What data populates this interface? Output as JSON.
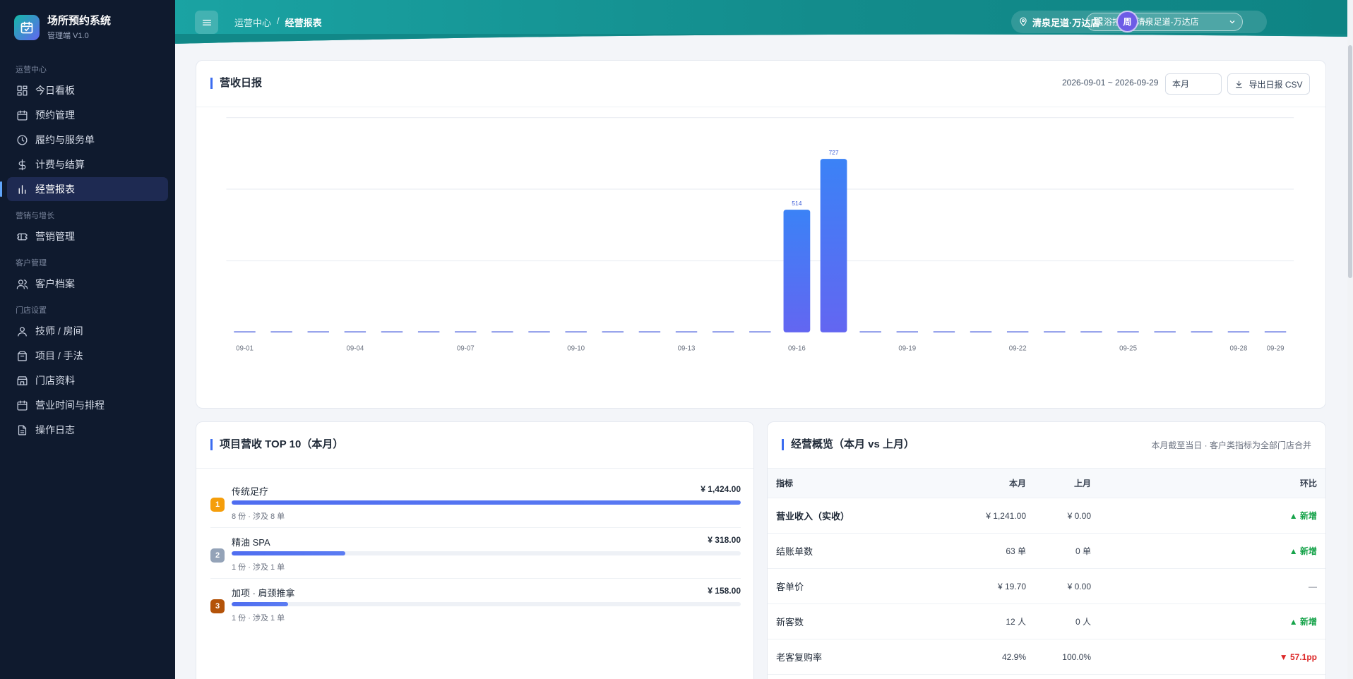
{
  "app": {
    "title": "场所预约系统",
    "subtitle": "管理端 V1.0"
  },
  "sidebar": {
    "groups": [
      {
        "label": "运营中心",
        "items": [
          {
            "label": "今日看板",
            "icon": "dashboard-icon"
          },
          {
            "label": "预约管理",
            "icon": "calendar-icon"
          },
          {
            "label": "履约与服务单",
            "icon": "clock-icon"
          },
          {
            "label": "计费与结算",
            "icon": "dollar-icon"
          },
          {
            "label": "经营报表",
            "icon": "bar-chart-icon",
            "active": true
          }
        ]
      },
      {
        "label": "营销与增长",
        "items": [
          {
            "label": "营销管理",
            "icon": "ticket-icon"
          }
        ]
      },
      {
        "label": "客户管理",
        "items": [
          {
            "label": "客户档案",
            "icon": "users-icon"
          }
        ]
      },
      {
        "label": "门店设置",
        "items": [
          {
            "label": "技师 / 房间",
            "icon": "user-icon"
          },
          {
            "label": "项目 / 手法",
            "icon": "package-icon"
          },
          {
            "label": "门店资料",
            "icon": "store-icon"
          },
          {
            "label": "营业时间与排程",
            "icon": "calendar-icon"
          },
          {
            "label": "操作日志",
            "icon": "file-icon"
          }
        ]
      }
    ]
  },
  "header": {
    "breadcrumb": [
      "运营中心",
      "/",
      "经营报表"
    ],
    "store_name": "清泉足道·万达店",
    "store_select": "足浴按摩 · 清泉足道-万达店"
  },
  "user": {
    "avatar_text": "周"
  },
  "revenue": {
    "title": "营收日报",
    "date_range": "2026-09-01 ~ 2026-09-29",
    "period": "本月",
    "export_label": "导出日报 CSV"
  },
  "chart_data": {
    "type": "bar",
    "categories": [
      "09-01",
      "09-02",
      "09-03",
      "09-04",
      "09-05",
      "09-06",
      "09-07",
      "09-08",
      "09-09",
      "09-10",
      "09-11",
      "09-12",
      "09-13",
      "09-14",
      "09-15",
      "09-16",
      "09-17",
      "09-18",
      "09-19",
      "09-20",
      "09-21",
      "09-22",
      "09-23",
      "09-24",
      "09-25",
      "09-26",
      "09-27",
      "09-28",
      "09-29"
    ],
    "values": [
      0,
      0,
      0,
      0,
      0,
      0,
      0,
      0,
      0,
      0,
      0,
      0,
      0,
      0,
      0,
      514,
      727,
      0,
      0,
      0,
      0,
      0,
      0,
      0,
      0,
      0,
      0,
      0,
      0
    ],
    "tick_labels": [
      "09-01",
      "09-04",
      "09-07",
      "09-10",
      "09-13",
      "09-16",
      "09-19",
      "09-22",
      "09-25",
      "09-28",
      "09-29"
    ],
    "ylim": [
      0,
      900
    ],
    "grid": true,
    "colors": {
      "bar_top": "#3b82f6",
      "bar_bottom": "#6366f1",
      "zero_bar": "#5b6fe0",
      "label": "#3b5bd6"
    }
  },
  "top_items": {
    "title": "项目营收 TOP 10（本月）",
    "items": [
      {
        "rank": "1",
        "name": "传统足疗",
        "amount": "¥ 1,424.00",
        "sub": "8 份 · 涉及 8 单",
        "share": 1.0,
        "color": "#f59e0b"
      },
      {
        "rank": "2",
        "name": "精油 SPA",
        "amount": "¥ 318.00",
        "sub": "1 份 · 涉及 1 单",
        "share": 0.223,
        "color": "#94a3b8"
      },
      {
        "rank": "3",
        "name": "加项 · 肩颈推拿",
        "amount": "¥ 158.00",
        "sub": "1 份 · 涉及 1 单",
        "share": 0.111,
        "color": "#b45309"
      }
    ]
  },
  "overview": {
    "title": "经营概览（本月 vs 上月）",
    "note": "本月截至当日 · 客户类指标为全部门店合并",
    "headers": [
      "指标",
      "本月",
      "上月",
      "环比"
    ],
    "rows": [
      {
        "metric": "营业收入（实收）",
        "cur": "¥ 1,241.00",
        "prev": "¥ 0.00",
        "change": "▲ 新增",
        "trend": "up",
        "bold": true
      },
      {
        "metric": "结账单数",
        "cur": "63 单",
        "prev": "0 单",
        "change": "▲ 新增",
        "trend": "up"
      },
      {
        "metric": "客单价",
        "cur": "¥ 19.70",
        "prev": "¥ 0.00",
        "change": "—",
        "trend": "neu"
      },
      {
        "metric": "新客数",
        "cur": "12 人",
        "prev": "0 人",
        "change": "▲ 新增",
        "trend": "up"
      },
      {
        "metric": "老客复购率",
        "cur": "42.9%",
        "prev": "100.0%",
        "change": "▼ 57.1pp",
        "trend": "down"
      }
    ]
  }
}
